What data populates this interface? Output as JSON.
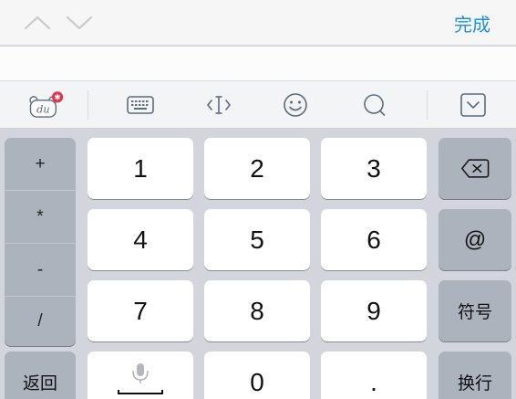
{
  "accessory_bar": {
    "done_label": "完成",
    "prev_icon": "chevron-up",
    "next_icon": "chevron-down"
  },
  "toolbar": {
    "icons": [
      "du-bear-logo",
      "keyboard",
      "text-cursor",
      "emoji",
      "search",
      "collapse-keyboard"
    ]
  },
  "keyboard": {
    "symbols": [
      "+",
      "*",
      "-",
      "/"
    ],
    "digits": [
      "1",
      "2",
      "3",
      "4",
      "5",
      "6",
      "7",
      "8",
      "9",
      "0"
    ],
    "dot": ".",
    "at": "@",
    "symbols_key": "符号",
    "back_key": "返回",
    "newline_key": "换行"
  },
  "colors": {
    "accent": "#1d8fe8",
    "keyboard_bg": "#d2d5db",
    "function_key": "#adb3bc"
  }
}
